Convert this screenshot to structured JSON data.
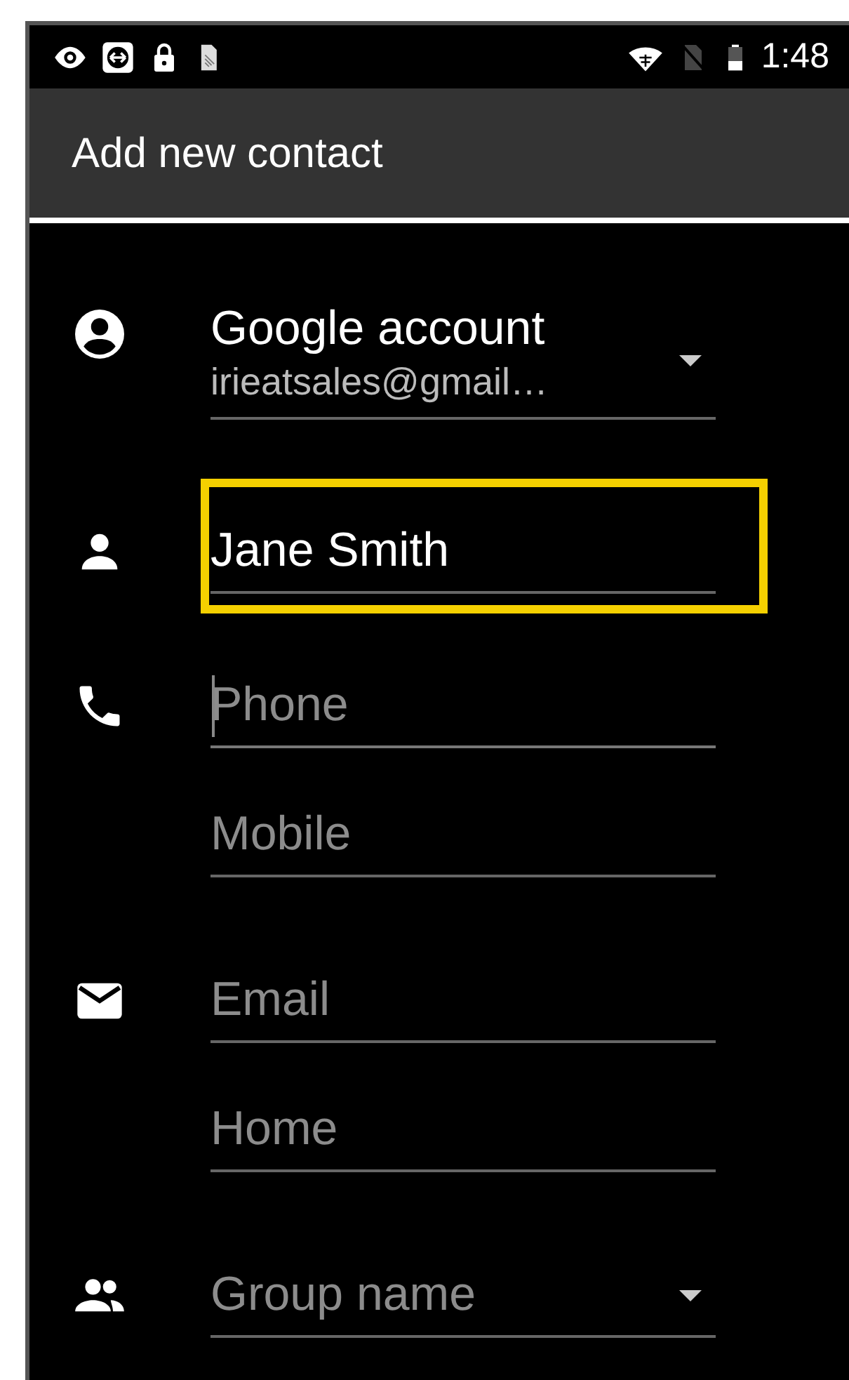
{
  "status_bar": {
    "time": "1:48"
  },
  "app_bar": {
    "title": "Add new contact"
  },
  "account": {
    "title": "Google account",
    "email": "irieatsales@gmail…"
  },
  "sections": [
    {
      "kind": "person",
      "fields": [
        {
          "kind": "text",
          "value": "Jane Smith",
          "highlighted": true,
          "focused": false
        }
      ]
    },
    {
      "kind": "phone",
      "fields": [
        {
          "kind": "text",
          "placeholder": "Phone",
          "highlighted": false,
          "focused": true
        },
        {
          "kind": "text",
          "placeholder": "Mobile",
          "highlighted": false,
          "focused": false
        }
      ]
    },
    {
      "kind": "email",
      "fields": [
        {
          "kind": "text",
          "placeholder": "Email",
          "highlighted": false,
          "focused": false
        },
        {
          "kind": "text",
          "placeholder": "Home",
          "highlighted": false,
          "focused": false
        }
      ]
    },
    {
      "kind": "group",
      "fields": [
        {
          "kind": "dropdown",
          "placeholder": "Group name",
          "highlighted": false,
          "focused": false
        }
      ]
    }
  ]
}
